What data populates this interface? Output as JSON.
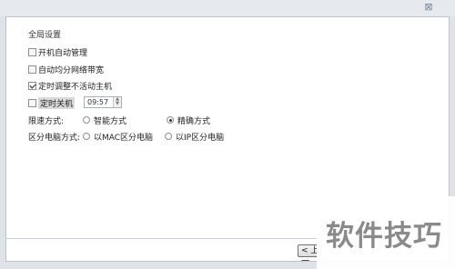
{
  "window": {
    "close_glyph": "⊠"
  },
  "settings": {
    "title": "全局设置",
    "checkboxes": [
      {
        "label": "开机自动管理",
        "checked": false
      },
      {
        "label": "自动均分网络带宽",
        "checked": false
      },
      {
        "label": "定时调整不活动主机",
        "checked": true
      },
      {
        "label": "定时关机",
        "checked": false
      }
    ],
    "shutdown_time": "09:57",
    "restrict_mode": {
      "label": "限速方式:",
      "options": [
        {
          "label": "智能方式",
          "selected": false
        },
        {
          "label": "精确方式",
          "selected": true
        }
      ]
    },
    "allocate_by": {
      "label": "区分电脑方式:",
      "options": [
        {
          "label": "以MAC区分电脑",
          "selected": false
        },
        {
          "label": "以IP区分电脑",
          "selected": false
        }
      ]
    }
  },
  "footer": {
    "prev_label": "< 上一"
  },
  "brand": {
    "text": "软件技巧"
  }
}
